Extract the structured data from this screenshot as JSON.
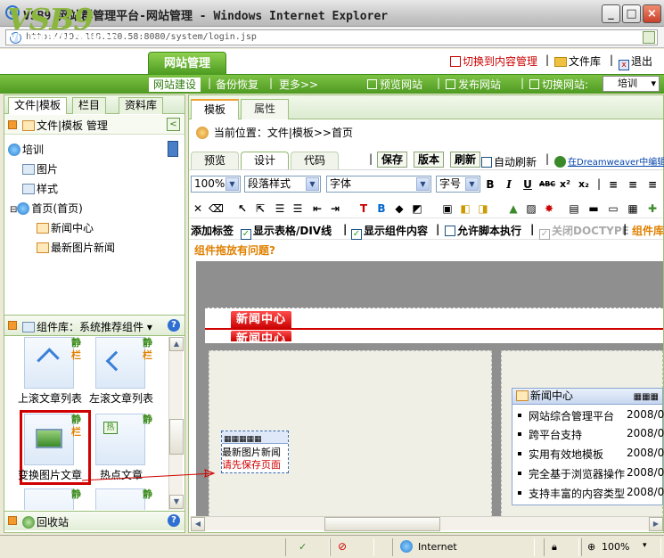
{
  "window": {
    "title": "VSB9 网站群管理平台-网站管理 - Windows Internet Explorer",
    "url": "http://192.168.120.58:8080/system/login.jsp"
  },
  "header": {
    "logo": "VSB9",
    "logo_sub": "Visual SiteBuilder",
    "main_button": "网站管理",
    "links": {
      "switch_content": "切换到内容管理",
      "file_lib": "文件库",
      "logout": "退出"
    },
    "nav": {
      "site_build": "网站建设",
      "backup": "备份恢复",
      "more": "更多>>",
      "preview": "预览网站",
      "publish": "发布网站",
      "switch_site": "切换网站:",
      "site_value": "培训"
    }
  },
  "left": {
    "tabs": [
      "文件|模板",
      "栏目",
      "资料库"
    ],
    "template_title": "文件|模板 管理",
    "tree": {
      "root": "培训",
      "images": "图片",
      "styles": "样式",
      "home": "首页(首页)",
      "news_center": "新闻中心",
      "latest_img_news": "最新图片新闻"
    },
    "complib": {
      "label": "组件库：系统推荐组件"
    },
    "components": [
      {
        "name": "上滚文章列表",
        "s1": "静",
        "s2": "栏"
      },
      {
        "name": "左滚文章列表",
        "s1": "静",
        "s2": "栏"
      },
      {
        "name": "变换图片文章",
        "s1": "静",
        "s2": "栏"
      },
      {
        "name": "热点文章",
        "s1": "静",
        "s2": ""
      },
      {
        "name": "",
        "s1": "静",
        "s2": ""
      },
      {
        "name": "",
        "s1": "静",
        "s2": ""
      }
    ],
    "recycle": "回收站"
  },
  "right": {
    "tabs": [
      "模板",
      "属性"
    ],
    "crumb": "当前位置：文件|模板>>首页",
    "design_tabs": [
      "预览",
      "设计",
      "代码"
    ],
    "buttons": {
      "save": "保存",
      "version": "版本",
      "refresh": "刷新"
    },
    "auto_refresh": "自动刷新",
    "dreamweaver": "在Dreamweaver中编辑",
    "zoom": "100%",
    "para_style": "段落样式",
    "font": "字体",
    "font_size": "字号",
    "fmt": [
      "B",
      "I",
      "U",
      "ABC",
      "x²",
      "x₂"
    ],
    "options": {
      "add_tag": "添加标签",
      "show_table": "显示表格/DIV线",
      "show_comp": "显示组件内容",
      "allow_script": "允许脚本执行",
      "close_doctype": "关闭DOCTYPE",
      "comp_more": "组件库"
    },
    "warn": "组件拖放有问题?",
    "canvas": {
      "tab1": "新闻中心",
      "tab2": "新闻中心",
      "comp_title": "最新图片新闻",
      "comp_note": "请先保存页面",
      "news_title": "新闻中心",
      "news": [
        {
          "t": "网站综合管理平台",
          "d": "2008/0"
        },
        {
          "t": "跨平台支持",
          "d": "2008/0"
        },
        {
          "t": "实用有效地模板",
          "d": "2008/0"
        },
        {
          "t": "完全基于浏览器操作",
          "d": "2008/0"
        },
        {
          "t": "支持丰富的内容类型",
          "d": "2008/0"
        }
      ]
    }
  },
  "status": {
    "zone": "Internet",
    "zoom": "100%"
  }
}
